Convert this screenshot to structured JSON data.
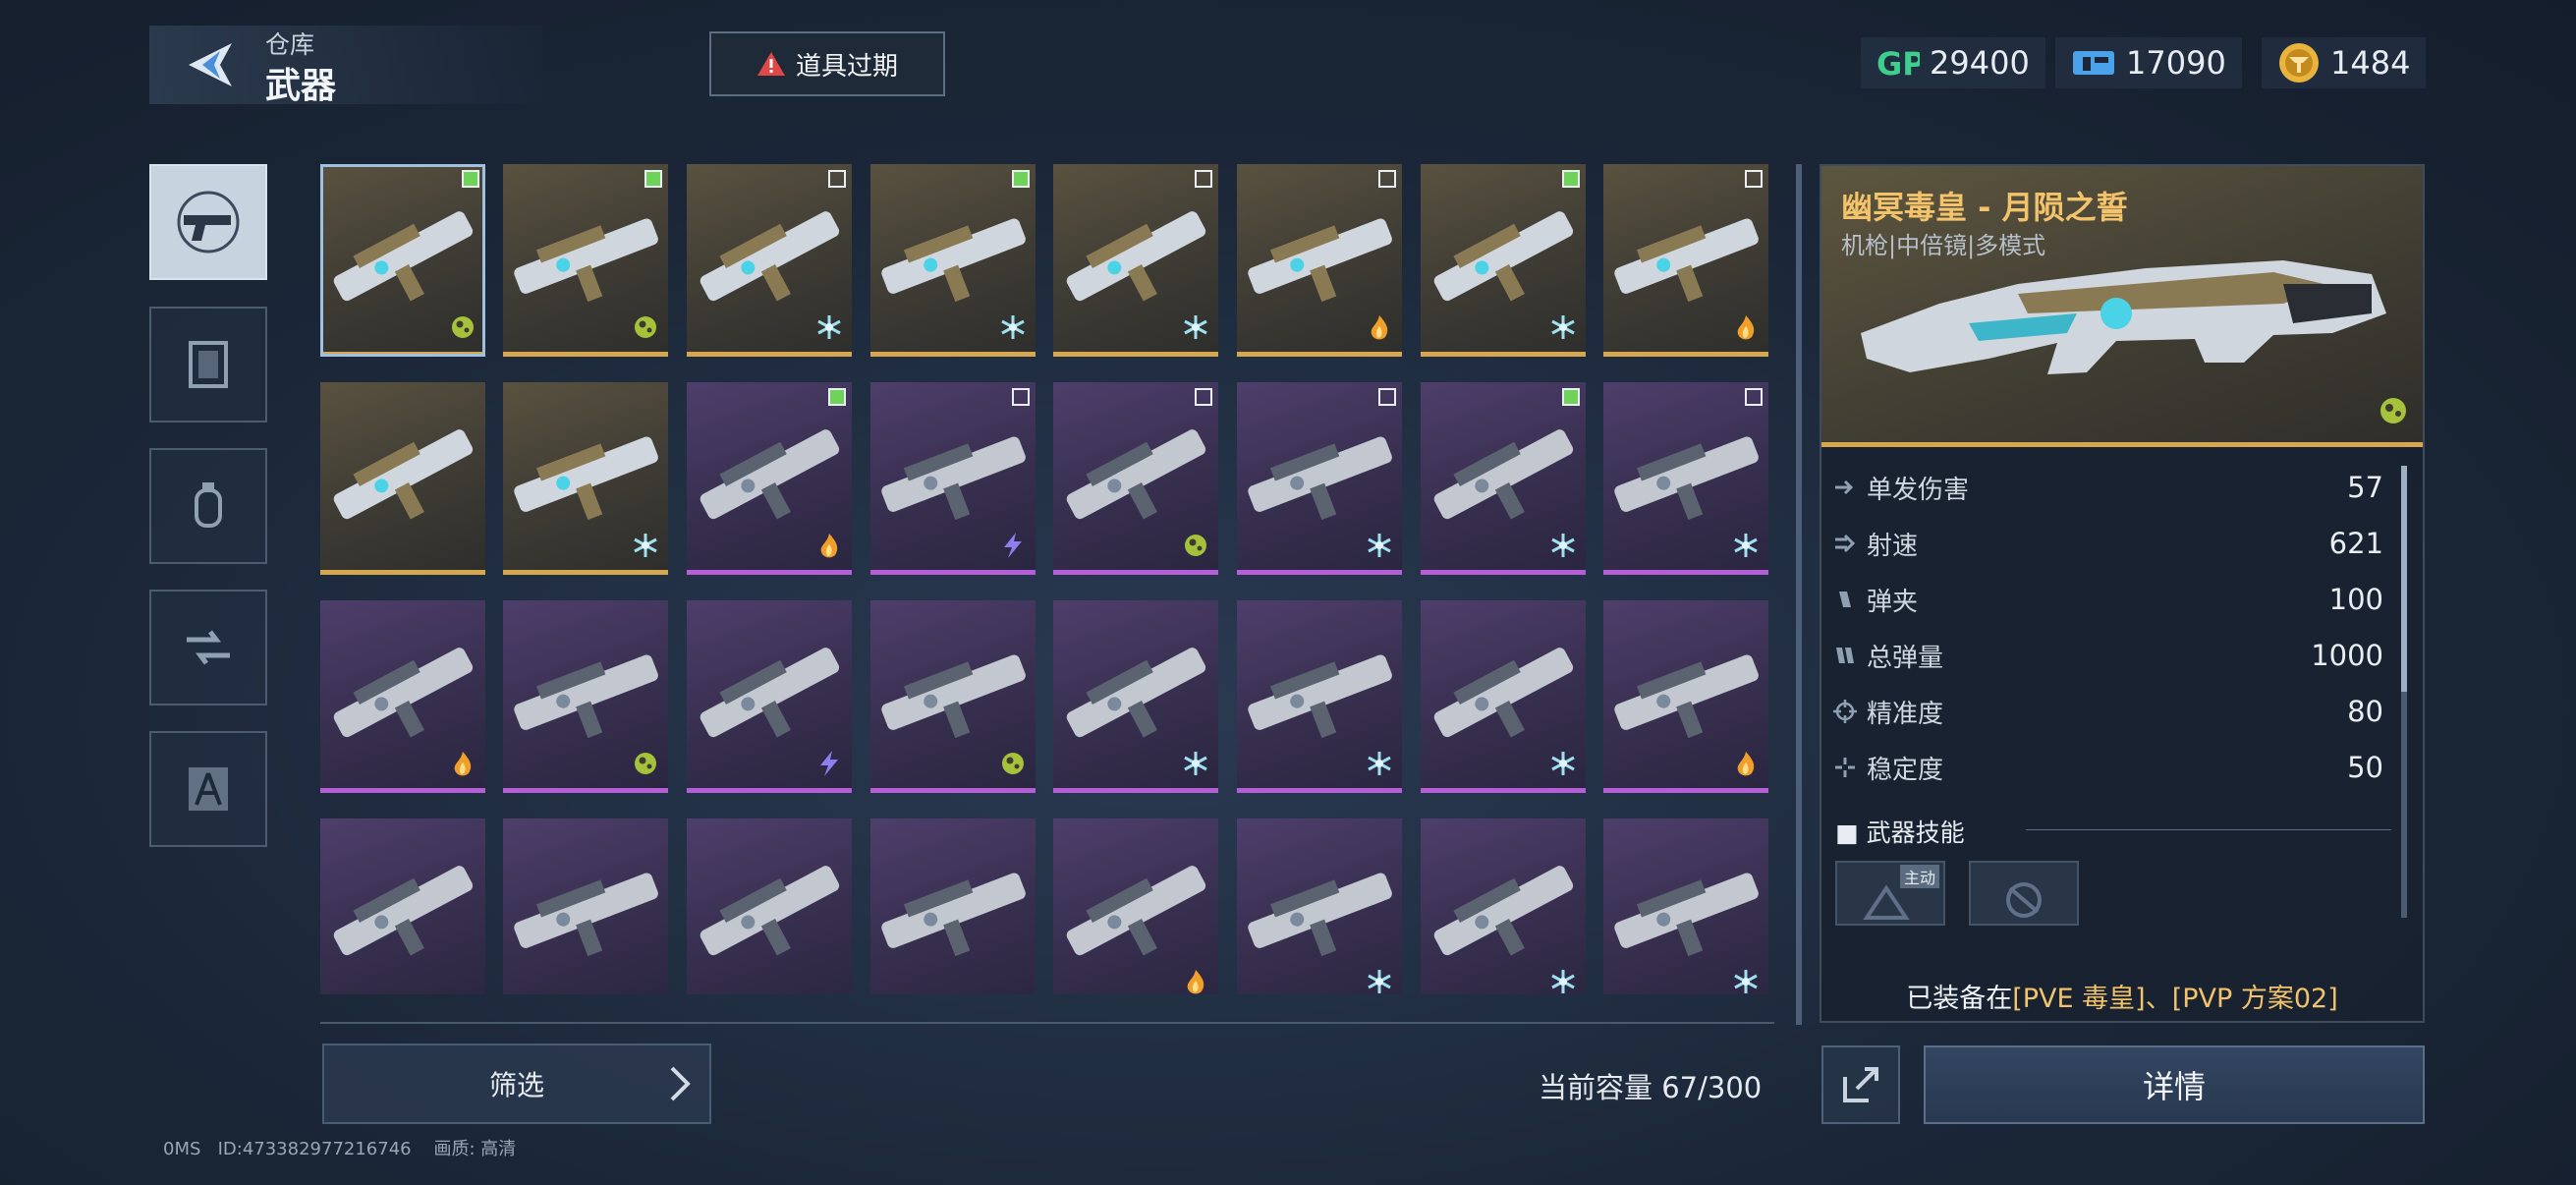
{
  "header": {
    "breadcrumb_parent": "仓库",
    "page_title": "武器",
    "expire_button_label": "道具过期",
    "currencies": [
      {
        "icon": "gp-coin-icon",
        "value": "29400"
      },
      {
        "icon": "ticket-icon",
        "value": "17090"
      },
      {
        "icon": "gold-token-icon",
        "value": "1484"
      }
    ]
  },
  "sidebar": {
    "tabs": [
      {
        "icon": "pistol-icon",
        "active": true
      },
      {
        "icon": "card-icon",
        "active": false
      },
      {
        "icon": "grenade-icon",
        "active": false
      },
      {
        "icon": "gear-swap-icon",
        "active": false
      },
      {
        "icon": "blueprint-icon",
        "active": false
      }
    ]
  },
  "grid": {
    "items": [
      {
        "rarity": "gold",
        "check": "on",
        "badge": "bio"
      },
      {
        "rarity": "gold",
        "check": "on",
        "badge": "bio"
      },
      {
        "rarity": "gold",
        "check": "off",
        "badge": "frost"
      },
      {
        "rarity": "gold",
        "check": "on",
        "badge": "frost"
      },
      {
        "rarity": "gold",
        "check": "off",
        "badge": "frost"
      },
      {
        "rarity": "gold",
        "check": "off",
        "badge": "fire"
      },
      {
        "rarity": "gold",
        "check": "on",
        "badge": "frost"
      },
      {
        "rarity": "gold",
        "check": "off",
        "badge": "fire"
      },
      {
        "rarity": "gold",
        "check": "none",
        "badge": "none"
      },
      {
        "rarity": "gold",
        "check": "none",
        "badge": "frost"
      },
      {
        "rarity": "purple",
        "check": "on",
        "badge": "fire"
      },
      {
        "rarity": "purple",
        "check": "off",
        "badge": "lightning"
      },
      {
        "rarity": "purple",
        "check": "off",
        "badge": "bio"
      },
      {
        "rarity": "purple",
        "check": "off",
        "badge": "frost"
      },
      {
        "rarity": "purple",
        "check": "on",
        "badge": "frost"
      },
      {
        "rarity": "purple",
        "check": "off",
        "badge": "frost"
      },
      {
        "rarity": "purple",
        "check": "none",
        "badge": "fire"
      },
      {
        "rarity": "purple",
        "check": "none",
        "badge": "bio"
      },
      {
        "rarity": "purple",
        "check": "none",
        "badge": "lightning"
      },
      {
        "rarity": "purple",
        "check": "none",
        "badge": "bio"
      },
      {
        "rarity": "purple",
        "check": "none",
        "badge": "frost"
      },
      {
        "rarity": "purple",
        "check": "none",
        "badge": "frost"
      },
      {
        "rarity": "purple",
        "check": "none",
        "badge": "frost"
      },
      {
        "rarity": "purple",
        "check": "none",
        "badge": "fire"
      },
      {
        "rarity": "purple",
        "check": "none",
        "badge": "none"
      },
      {
        "rarity": "purple",
        "check": "none",
        "badge": "none"
      },
      {
        "rarity": "purple",
        "check": "none",
        "badge": "none"
      },
      {
        "rarity": "purple",
        "check": "none",
        "badge": "none"
      },
      {
        "rarity": "purple",
        "check": "none",
        "badge": "fire"
      },
      {
        "rarity": "purple",
        "check": "none",
        "badge": "frost"
      },
      {
        "rarity": "purple",
        "check": "none",
        "badge": "frost"
      },
      {
        "rarity": "purple",
        "check": "none",
        "badge": "frost"
      }
    ]
  },
  "bottom": {
    "filter_label": "筛选",
    "capacity_text": "当前容量 67/300",
    "footer_ms": "0MS",
    "footer_id": "ID:473382977216746",
    "footer_quality": "画质: 高清"
  },
  "detail": {
    "weapon_name": "幽冥毒皇 - 月陨之誓",
    "weapon_subtitle": "机枪|中倍镜|多模式",
    "stats": [
      {
        "icon": "damage-icon",
        "label": "单发伤害",
        "value": "57"
      },
      {
        "icon": "fire-rate-icon",
        "label": "射速",
        "value": "621"
      },
      {
        "icon": "magazine-icon",
        "label": "弹夹",
        "value": "100"
      },
      {
        "icon": "total-ammo-icon",
        "label": "总弹量",
        "value": "1000"
      },
      {
        "icon": "crosshair-icon",
        "label": "精准度",
        "value": "80"
      },
      {
        "icon": "stability-icon",
        "label": "稳定度",
        "value": "50"
      }
    ],
    "skills_title": "武器技能",
    "skill_tag": "主动",
    "equipped_prefix": "已装备在",
    "equipped_value": "[PVE 毒皇]、[PVP 方案02]",
    "detail_button_label": "详情"
  },
  "colors": {
    "gold": "#d7a74f",
    "purple": "#b45fd8",
    "check_on": "#6fd35a",
    "accent_text": "#f2c36b"
  }
}
